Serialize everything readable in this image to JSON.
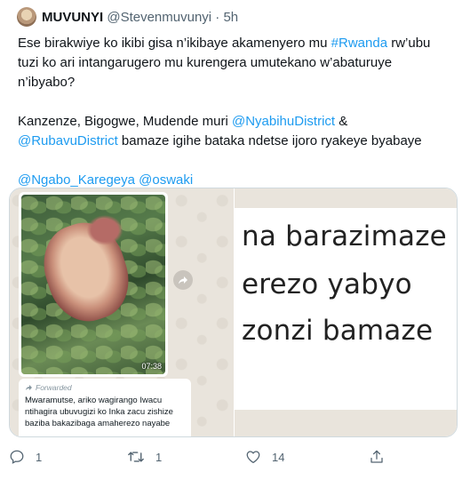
{
  "author": {
    "name": "MUVUNYI",
    "handle": "@Stevenmuvunyi",
    "separator": "·",
    "timestamp": "5h"
  },
  "tweet": {
    "line1_a": "Ese birakwiye ko ikibi gisa n’ikibaye akamenyero mu ",
    "hashtag": "#Rwanda",
    "line1_b": " rw’ubu",
    "line2": "tuzi ko ari intangarugero mu kurengera umutekano w’abaturuye",
    "line3": "n’ibyabo?",
    "line4_a": "Kanzenze, Bigogwe, Mudende muri ",
    "mention1": "@NyabihuDistrict",
    "line4_b": " &",
    "mention2": "@RubavuDistrict",
    "line5_b": " bamaze igihe bataka ndetse ijoro ryakeye byabaye",
    "mention3": "@Ngabo_Karegeya",
    "mention4": "@oswaki"
  },
  "media": {
    "video_duration": "07:38",
    "forwarded_label": "Forwarded",
    "message_text": "Mwaramutse, ariko wagirango Iwacu ntihagira ubuvugizi ko Inka zacu zishize baziba bakazibaga amaherezo nayabe",
    "zoom_lines": [
      "na barazimaze",
      "erezo yabyo",
      "zonzi bamaze"
    ]
  },
  "actions": {
    "reply_count": "1",
    "retweet_count": "1",
    "like_count": "14"
  }
}
